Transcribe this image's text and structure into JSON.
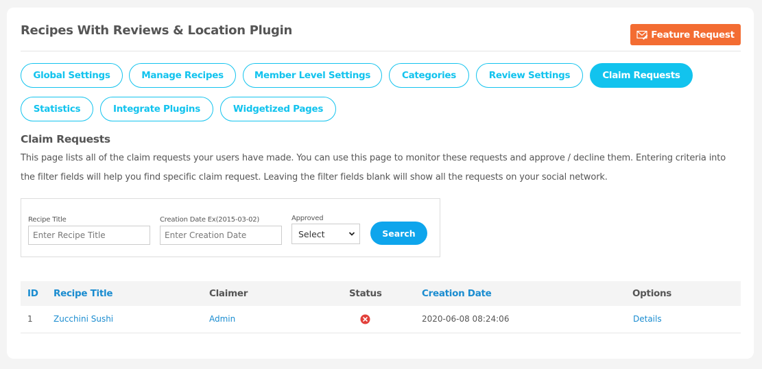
{
  "header": {
    "title": "Recipes With Reviews & Location Plugin",
    "feature_request_label": "Feature Request",
    "feature_request_icon": "mail-edit-icon",
    "feature_request_color": "#f36c32"
  },
  "tabs": [
    {
      "label": "Global Settings",
      "active": false
    },
    {
      "label": "Manage Recipes",
      "active": false
    },
    {
      "label": "Member Level Settings",
      "active": false
    },
    {
      "label": "Categories",
      "active": false
    },
    {
      "label": "Review Settings",
      "active": false
    },
    {
      "label": "Claim Requests",
      "active": true
    },
    {
      "label": "Statistics",
      "active": false
    },
    {
      "label": "Integrate Plugins",
      "active": false
    },
    {
      "label": "Widgetized Pages",
      "active": false
    }
  ],
  "accent_color": "#12c3ee",
  "section": {
    "title": "Claim Requests",
    "description": "This page lists all of the claim requests your users have made. You can use this page to monitor these requests and approve / decline them. Entering criteria into the filter fields will help you find specific claim request. Leaving the filter fields blank will show all the requests on your social network."
  },
  "filter": {
    "recipe_title_label": "Recipe Title",
    "recipe_title_value": "",
    "recipe_title_placeholder": "Enter Recipe Title",
    "creation_date_label": "Creation Date Ex(2015-03-02)",
    "creation_date_value": "",
    "creation_date_placeholder": "Enter Creation Date",
    "approved_label": "Approved",
    "approved_selected": "Select",
    "search_label": "Search"
  },
  "table": {
    "columns": [
      "ID",
      "Recipe Title",
      "Claimer",
      "Status",
      "Creation Date",
      "Options"
    ],
    "rows": [
      {
        "id": "1",
        "recipe_title": "Zucchini Sushi",
        "claimer": "Admin",
        "status": "declined",
        "status_icon": "x-circle-icon",
        "creation_date": "2020-06-08 08:24:06",
        "option": "Details"
      }
    ]
  }
}
